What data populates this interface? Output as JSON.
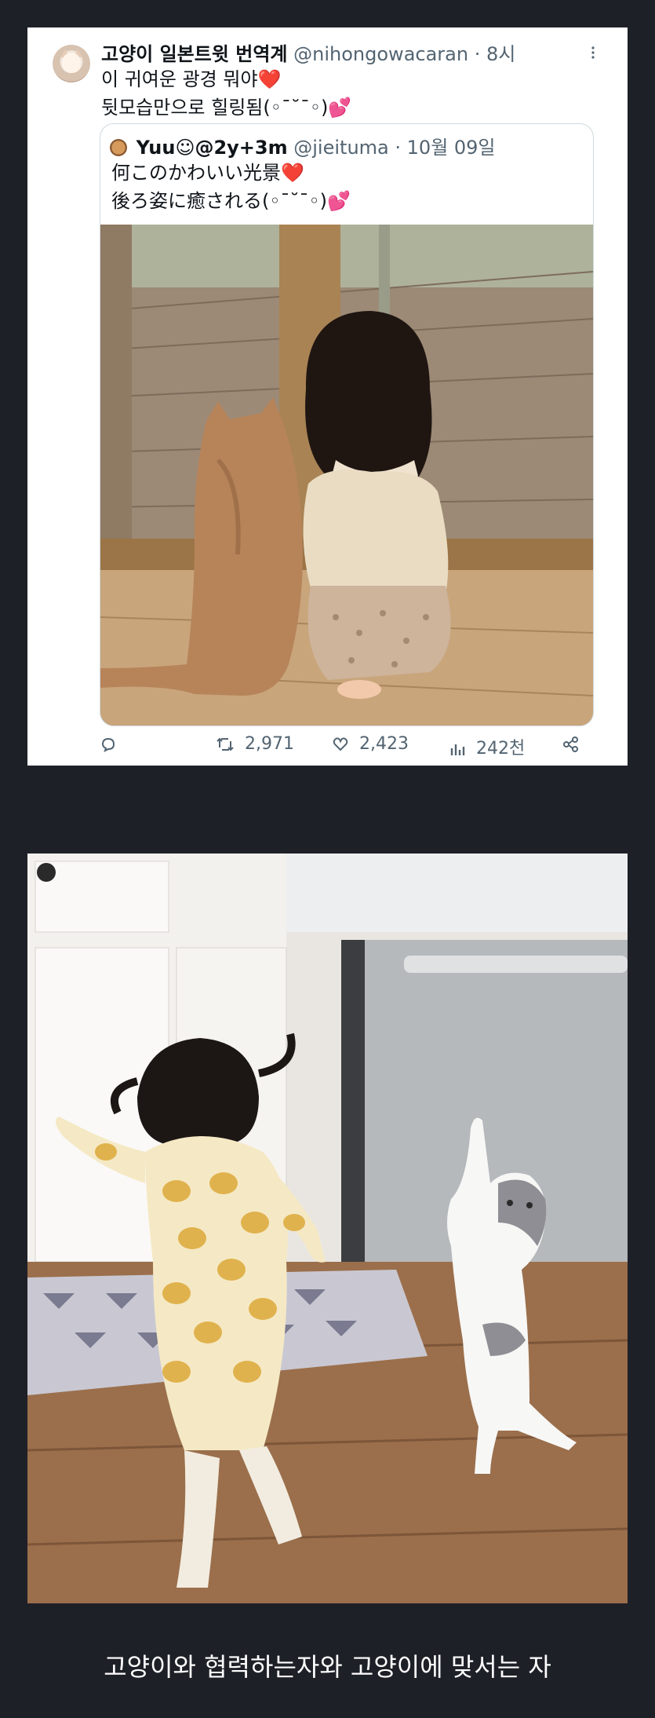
{
  "tweet": {
    "author_name": "고양이 일본트윗 번역계",
    "handle": "@nihongowacaran",
    "time": "· 8시",
    "text_line1": "이 귀여운 광경 뭐야❤️",
    "text_line2": "뒷모습만으로 힐링됨(◦ˉ˘ˉ◦)💕"
  },
  "quote": {
    "author_name": "Yuu☺@2y+3m",
    "handle": "@jieituma",
    "date": "· 10월 09일",
    "text_line1": "何このかわいい光景❤️",
    "text_line2": "後ろ姿に癒される(◦ˉ˘ˉ◦)💕"
  },
  "actions": {
    "retweets": "2,971",
    "likes": "2,423",
    "views": "242천"
  },
  "icons": {
    "reply": "reply-icon",
    "retweet": "retweet-icon",
    "like": "heart-icon",
    "views": "views-icon",
    "share": "share-icon",
    "more": "more-icon"
  },
  "caption": "고양이와 협력하는자와 고양이에 맞서는 자",
  "colors": {
    "page_bg": "#1e2027",
    "card_bg": "#ffffff",
    "muted_text": "#536471"
  }
}
